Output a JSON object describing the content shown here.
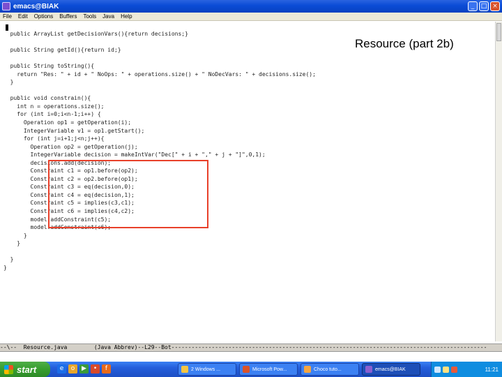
{
  "window": {
    "title": "emacs@BIAK",
    "buttons": {
      "minimize": "_",
      "maximize": "□",
      "close": "×"
    }
  },
  "menu": [
    "File",
    "Edit",
    "Options",
    "Buffers",
    "Tools",
    "Java",
    "Help"
  ],
  "overlay_title": "Resource (part 2b)",
  "code_lines": [
    "  public ArrayList getDecisionVars(){return decisions;}",
    "",
    "  public String getId(){return id;}",
    "",
    "  public String toString(){",
    "    return \"Res: \" + id + \" NoOps: \" + operations.size() + \" NoDecVars: \" + decisions.size();",
    "  }",
    "",
    "  public void constrain(){",
    "    int n = operations.size();",
    "    for (int i=0;i<n-1;i++) {",
    "      Operation op1 = getOperation(i);",
    "      IntegerVariable v1 = op1.getStart();",
    "      for (int j=i+1;j<n;j++){",
    "        Operation op2 = getOperation(j);",
    "        IntegerVariable decision = makeIntVar(\"Dec[\" + i + \",\" + j + \"]\",0,1);",
    "        decisions.add(decision);",
    "        Constraint c1 = op1.before(op2);",
    "        Constraint c2 = op2.before(op1);",
    "        Constraint c3 = eq(decision,0);",
    "        Constraint c4 = eq(decision,1);",
    "        Constraint c5 = implies(c3,c1);",
    "        Constraint c6 = implies(c4,c2);",
    "        model.addConstraint(c5);",
    "        model.addConstraint(c6);",
    "      }",
    "    }",
    "",
    "  }",
    "}"
  ],
  "modeline": "--\\--  Resource.java        (Java Abbrev)--L29--Bot----------------------------------------------------------------------------------------------",
  "taskbar": {
    "start_label": "start",
    "quick_launch": [
      {
        "icon": "internet-explorer-icon",
        "glyph": "e",
        "color": "#1c6ee8"
      },
      {
        "icon": "outlook-icon",
        "glyph": "o",
        "color": "#e8a62a"
      },
      {
        "icon": "media-player-icon",
        "glyph": "▶",
        "color": "#3a9a3a"
      },
      {
        "icon": "messenger-icon",
        "glyph": "•",
        "color": "#d84a2a"
      },
      {
        "icon": "firefox-icon",
        "glyph": "f",
        "color": "#e86a1a"
      }
    ],
    "tasks": [
      {
        "label": "2 Windows ...",
        "color": "#f5c542",
        "active": false
      },
      {
        "label": "Microsoft Pow...",
        "color": "#d9532b",
        "active": false
      },
      {
        "label": "Choco tuto...",
        "color": "#f5a542",
        "active": false
      },
      {
        "label": "emacs@BIAK",
        "color": "#8a5fd0",
        "active": true
      }
    ],
    "clock": "11:21"
  }
}
